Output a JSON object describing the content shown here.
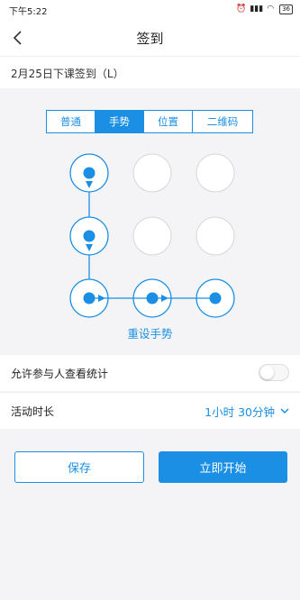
{
  "status_bar": {
    "time": "下午5:22",
    "icons": [
      "alarm-off-icon",
      "alarm-icon",
      "signal-icon",
      "wifi-icon"
    ],
    "battery": "36"
  },
  "header": {
    "title": "签到",
    "back_icon": "chevron-left-icon"
  },
  "subtitle": "2月25日下课签到（L）",
  "tabs": [
    {
      "label": "普通",
      "active": false
    },
    {
      "label": "手势",
      "active": true
    },
    {
      "label": "位置",
      "active": false
    },
    {
      "label": "二维码",
      "active": false
    }
  ],
  "gesture": {
    "grid_size": 3,
    "selected_sequence": [
      0,
      3,
      6,
      7,
      8
    ],
    "reset_label": "重设手势",
    "accent_color": "#1a8fe3"
  },
  "settings": {
    "stats_label": "允许参与人查看统计",
    "stats_enabled": false,
    "duration_label": "活动时长",
    "duration_value": "1小时 30分钟"
  },
  "actions": {
    "save_label": "保存",
    "start_label": "立即开始"
  }
}
